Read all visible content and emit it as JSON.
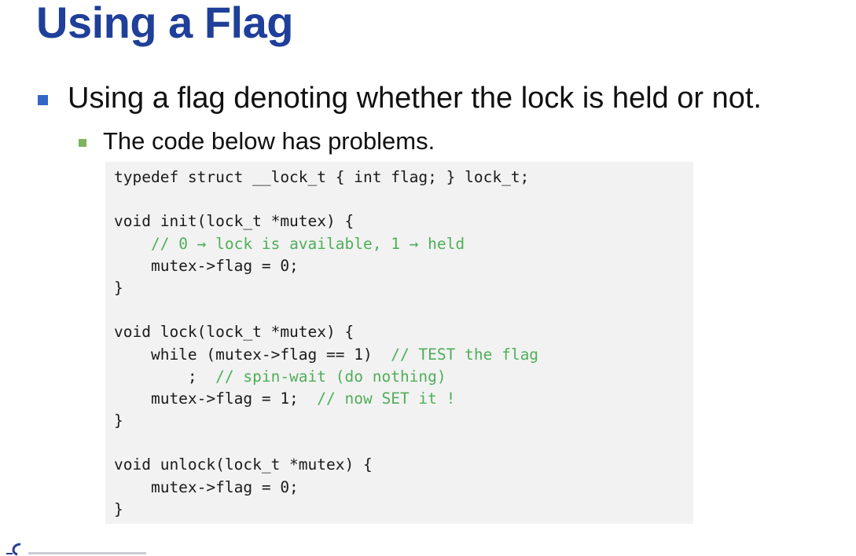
{
  "slide": {
    "title": "Using a Flag",
    "bullet1": "Using a flag denoting whether the lock is held or not.",
    "bullet2": "The code below has problems."
  },
  "code": {
    "lines": [
      {
        "code": "typedef struct __lock_t { int flag; } lock_t;",
        "comment": ""
      },
      {
        "code": "",
        "comment": ""
      },
      {
        "code": "void init(lock_t *mutex) {",
        "comment": ""
      },
      {
        "code": "    ",
        "comment": "// 0 → lock is available, 1 → held"
      },
      {
        "code": "    mutex->flag = 0;",
        "comment": ""
      },
      {
        "code": "}",
        "comment": ""
      },
      {
        "code": "",
        "comment": ""
      },
      {
        "code": "void lock(lock_t *mutex) {",
        "comment": ""
      },
      {
        "code": "    while (mutex->flag == 1)  ",
        "comment": "// TEST the flag"
      },
      {
        "code": "        ;  ",
        "comment": "// spin-wait (do nothing)"
      },
      {
        "code": "    mutex->flag = 1;  ",
        "comment": "// now SET it !"
      },
      {
        "code": "}",
        "comment": ""
      },
      {
        "code": "",
        "comment": ""
      },
      {
        "code": "void unlock(lock_t *mutex) {",
        "comment": ""
      },
      {
        "code": "    mutex->flag = 0;",
        "comment": ""
      },
      {
        "code": "}",
        "comment": ""
      }
    ]
  },
  "colors": {
    "title": "#1f3f99",
    "bullet_l1": "#3466c8",
    "bullet_l2": "#7fb55a",
    "comment": "#4fae5a",
    "code_bg": "#f2f2f2"
  }
}
